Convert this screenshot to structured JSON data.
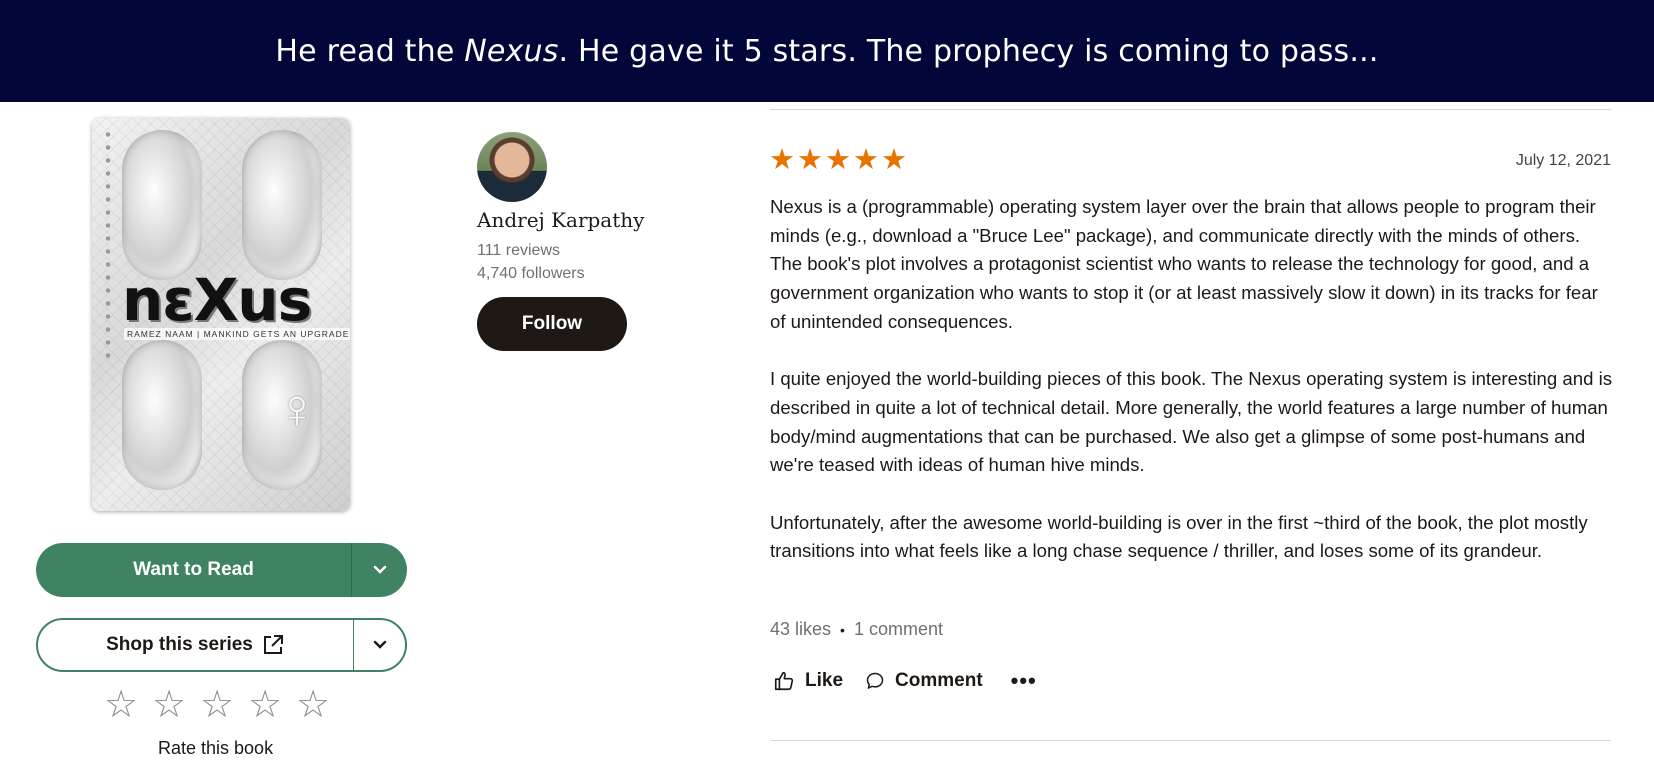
{
  "banner": {
    "before": "He read the ",
    "book": "Nexus",
    "after": ". He gave it 5 stars. The prophecy is coming to pass..."
  },
  "book": {
    "cover_title": "nεXus",
    "cover_subtitle": "RAMEZ NAAM | MANKIND GETS AN UPGRADE",
    "want_to_read_label": "Want to Read",
    "shop_label": "Shop this series",
    "rate_label": "Rate this book",
    "rate_max": 5,
    "user_rating": 0
  },
  "author": {
    "name": "Andrej Karpathy",
    "reviews": "111 reviews",
    "followers": "4,740 followers",
    "follow_label": "Follow"
  },
  "review": {
    "rating": 5,
    "date": "July 12, 2021",
    "paragraphs": [
      "Nexus is a (programmable) operating system layer over the brain that allows people to program their minds (e.g., download a \"Bruce Lee\" package), and communicate directly with the minds of others. The book's plot involves a protagonist scientist who wants to release the technology for good, and a government organization who wants to stop it (or at least massively slow it down) in its tracks for fear of unintended consequences.",
      "I quite enjoyed the world-building pieces of this book. The Nexus operating system is interesting and is described in quite a lot of technical detail. More generally, the world features a large number of human body/mind augmentations that can be purchased. We also get a glimpse of some post-humans and we're teased with ideas of human hive minds.",
      "Unfortunately, after the awesome world-building is over in the first ~third of the book, the plot mostly transitions into what feels like a long chase sequence / thriller, and loses some of its grandeur."
    ],
    "likes": "43 likes",
    "comments": "1 comment",
    "like_label": "Like",
    "comment_label": "Comment",
    "more_label": "•••"
  },
  "colors": {
    "banner_bg": "#020639",
    "star_orange": "#e87400",
    "green": "#3f8363",
    "dark": "#1e1915"
  }
}
